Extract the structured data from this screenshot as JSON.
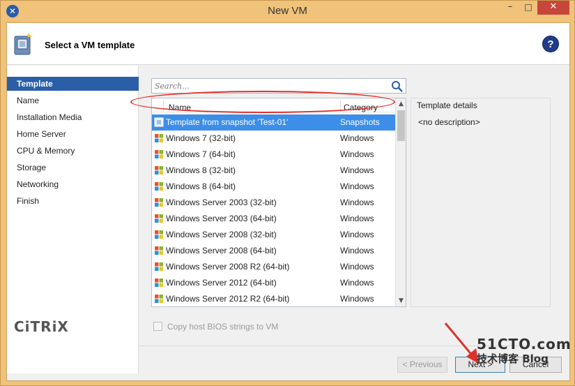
{
  "window": {
    "title": "New VM",
    "app_icon": "✕"
  },
  "window_controls": {
    "minimize": "–",
    "maximize": "□",
    "close": "✕"
  },
  "header": {
    "title": "Select a VM template",
    "help_label": "?"
  },
  "sidebar": {
    "items": [
      {
        "label": "Template",
        "active": true
      },
      {
        "label": "Name",
        "active": false
      },
      {
        "label": "Installation Media",
        "active": false
      },
      {
        "label": "Home Server",
        "active": false
      },
      {
        "label": "CPU & Memory",
        "active": false
      },
      {
        "label": "Storage",
        "active": false
      },
      {
        "label": "Networking",
        "active": false
      },
      {
        "label": "Finish",
        "active": false
      }
    ],
    "brand": "CiTRiX"
  },
  "search": {
    "placeholder": "Search...",
    "value": ""
  },
  "template_list": {
    "columns": {
      "name": "Name",
      "category": "Category"
    },
    "rows": [
      {
        "name": "Template from snapshot 'Test-01'",
        "category": "Snapshots",
        "selected": true,
        "icon": "snapshot-template-icon"
      },
      {
        "name": "Windows 7 (32-bit)",
        "category": "Windows",
        "selected": false,
        "icon": "windows-logo-icon"
      },
      {
        "name": "Windows 7 (64-bit)",
        "category": "Windows",
        "selected": false,
        "icon": "windows-logo-icon"
      },
      {
        "name": "Windows 8 (32-bit)",
        "category": "Windows",
        "selected": false,
        "icon": "windows-logo-icon"
      },
      {
        "name": "Windows 8 (64-bit)",
        "category": "Windows",
        "selected": false,
        "icon": "windows-logo-icon"
      },
      {
        "name": "Windows Server 2003 (32-bit)",
        "category": "Windows",
        "selected": false,
        "icon": "windows-logo-icon"
      },
      {
        "name": "Windows Server 2003 (64-bit)",
        "category": "Windows",
        "selected": false,
        "icon": "windows-logo-icon"
      },
      {
        "name": "Windows Server 2008 (32-bit)",
        "category": "Windows",
        "selected": false,
        "icon": "windows-logo-icon"
      },
      {
        "name": "Windows Server 2008 (64-bit)",
        "category": "Windows",
        "selected": false,
        "icon": "windows-logo-icon"
      },
      {
        "name": "Windows Server 2008 R2 (64-bit)",
        "category": "Windows",
        "selected": false,
        "icon": "windows-logo-icon"
      },
      {
        "name": "Windows Server 2012 (64-bit)",
        "category": "Windows",
        "selected": false,
        "icon": "windows-logo-icon"
      },
      {
        "name": "Windows Server 2012 R2 (64-bit)",
        "category": "Windows",
        "selected": false,
        "icon": "windows-logo-icon"
      }
    ]
  },
  "details": {
    "title": "Template details",
    "text": "<no description>"
  },
  "options": {
    "copy_bios_label": "Copy host BIOS strings to VM",
    "copy_bios_checked": false
  },
  "buttons": {
    "previous": "< Previous",
    "next": "Next >",
    "cancel": "Cancel"
  },
  "watermark": {
    "line1": "51CTO.com",
    "line2": "技术博客 Blog"
  },
  "colors": {
    "accent": "#2a5fa8",
    "selection": "#3d8ee8",
    "annotation": "#e0302a",
    "frame": "#f0c27a"
  }
}
